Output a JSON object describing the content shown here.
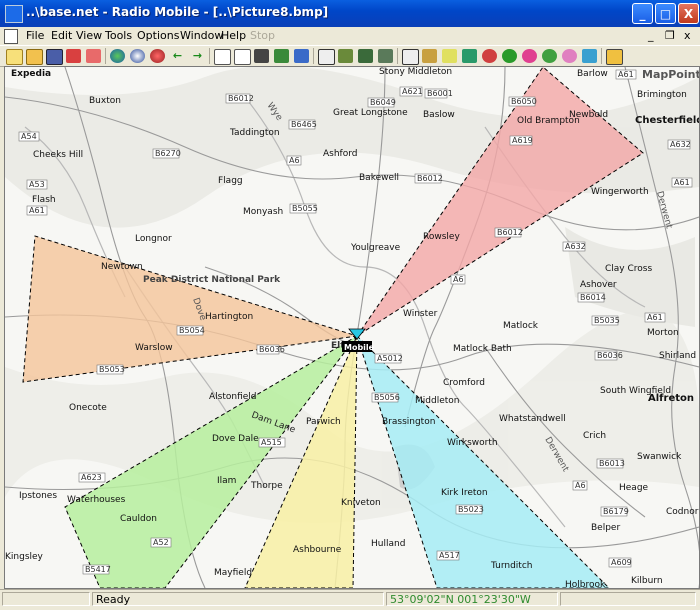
{
  "window": {
    "title": "..\\base.net - Radio Mobile - [..\\Picture8.bmp]",
    "minimize": "_",
    "maximize": "□",
    "close": "X"
  },
  "menu": {
    "items": [
      "File",
      "Edit",
      "View",
      "Tools",
      "Options",
      "Window",
      "Help",
      "Stop"
    ],
    "mdi_minimize": "_",
    "mdi_restore": "❐",
    "mdi_close": "x"
  },
  "toolbar": {
    "icons": [
      "new-icon",
      "open-icon",
      "save-icon",
      "unit-properties-icon",
      "network-properties-icon",
      "world-icon",
      "map-properties-icon",
      "radio-link-icon",
      "back-icon",
      "forward-icon",
      "print-icon",
      "copy-icon",
      "paste-icon",
      "picture-icon",
      "stack-icon",
      "rectangle-icon",
      "elevation-icon",
      "combine-icon",
      "fit-icon",
      "antenna-icon",
      "coverage-polar-icon",
      "coverage-cartesian-icon",
      "coverage-combined-icon",
      "route-icon",
      "path-icon",
      "landmark-icon"
    ]
  },
  "colors": {
    "sector_orange": "#f4c49a",
    "sector_red": "#f2a6a6",
    "sector_green": "#b6ef9e",
    "sector_yellow": "#f8f0a4",
    "sector_cyan": "#a6ecf4",
    "unit_marker": "#29c7e3"
  },
  "map": {
    "unit_label": "Mobile",
    "places": [
      "Expedia",
      "Buxton",
      "Stony Middleton",
      "Barlow",
      "MapPoint",
      "Brimington",
      "Chesterfield",
      "Taddington",
      "Great Longstone",
      "Baslow",
      "Old Brampton",
      "Newbold",
      "Cheeks Hill",
      "Ashford",
      "Bakewell",
      "Wingerworth",
      "Flagg",
      "Flash",
      "Monyash",
      "Longnor",
      "Youlgreave",
      "Rowsley",
      "Newtown",
      "Peak District National Park",
      "Clay Cross",
      "Ashover",
      "Hartington",
      "Winster",
      "Warslow",
      "Matlock",
      "Morton",
      "Matlock Bath",
      "Shirland",
      "Alstonfield",
      "Cromford",
      "South Wingfield",
      "Onecote",
      "Middleton",
      "Alfreton",
      "Dam Lane",
      "Parwich",
      "Brassington",
      "Whatstandwell",
      "Crich",
      "Dove Dale",
      "Wirksworth",
      "Swanwick",
      "Ilam",
      "Heage",
      "Ipstones",
      "Waterhouses",
      "Thorpe",
      "Kirk Ireton",
      "Codnor",
      "Cauldon",
      "Kniveton",
      "Belper",
      "Hulland",
      "Kingsley",
      "Ashbourne",
      "Turnditch",
      "Kilburn",
      "Mayfield",
      "Holbrook",
      "Wye",
      "Dove",
      "Derwent",
      "Elton"
    ],
    "roads": [
      "A6",
      "A623",
      "A621",
      "B6001",
      "B6049",
      "B6465",
      "B6012",
      "B6270",
      "B5055",
      "B5054",
      "A5012",
      "B5053",
      "B5056",
      "A632",
      "A619",
      "B6050",
      "A61",
      "A617",
      "B6036",
      "B6014",
      "B5035",
      "B6013",
      "B6179",
      "A609",
      "A517",
      "B5023",
      "B5417",
      "A52",
      "A515",
      "A54",
      "A53",
      "A61"
    ]
  },
  "status": {
    "panel1": "",
    "panel2": "Ready",
    "panel3": "53°09'02\"N 001°23'30\"W",
    "panel4": ""
  }
}
